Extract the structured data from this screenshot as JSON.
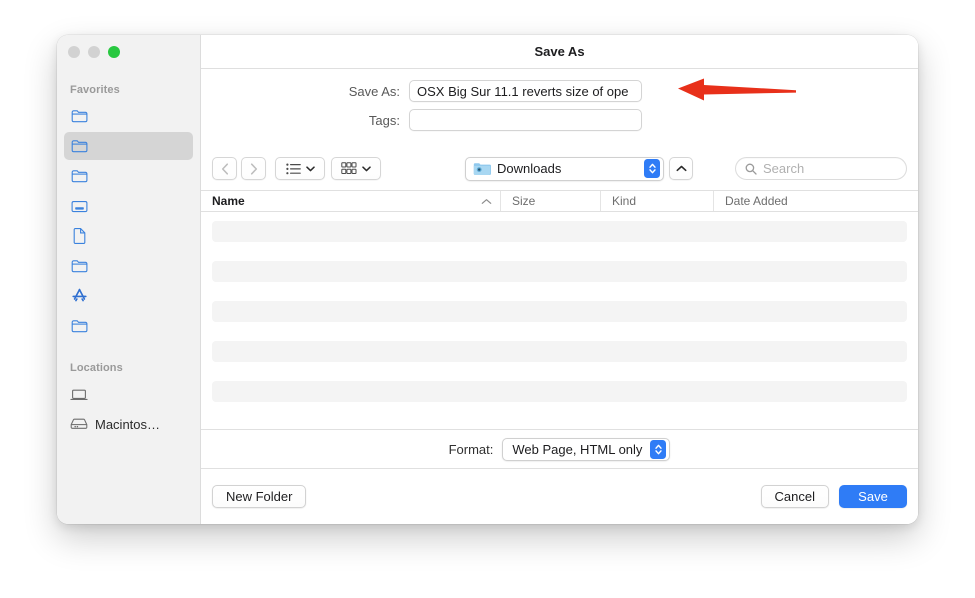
{
  "window": {
    "title": "Save As",
    "traffic_lights": [
      {
        "name": "close",
        "color": "#d2d2d2"
      },
      {
        "name": "minimize",
        "color": "#d2d2d2"
      },
      {
        "name": "zoom",
        "color": "#28c840"
      }
    ]
  },
  "sidebar": {
    "sections": [
      {
        "title": "Favorites",
        "items": [
          {
            "icon": "folder-icon",
            "label": "",
            "selected": false
          },
          {
            "icon": "folder-icon",
            "label": "",
            "selected": true
          },
          {
            "icon": "folder-icon",
            "label": "",
            "selected": false
          },
          {
            "icon": "desktop-icon",
            "label": "",
            "selected": false
          },
          {
            "icon": "document-icon",
            "label": "",
            "selected": false
          },
          {
            "icon": "folder-icon",
            "label": "",
            "selected": false
          },
          {
            "icon": "app-store-icon",
            "label": "",
            "selected": false
          },
          {
            "icon": "folder-icon",
            "label": "",
            "selected": false
          }
        ]
      },
      {
        "title": "Locations",
        "items": [
          {
            "icon": "laptop-icon",
            "label": "",
            "selected": false
          },
          {
            "icon": "hard-drive-icon",
            "label": "Macintos…",
            "selected": false
          }
        ]
      }
    ]
  },
  "name_fields": {
    "save_as_label": "Save As:",
    "save_as_value": "OSX Big Sur 11.1 reverts size of ope",
    "tags_label": "Tags:",
    "tags_value": "",
    "tags_placeholder": ""
  },
  "toolbar": {
    "back_icon": "chevron-left-icon",
    "forward_icon": "chevron-right-icon",
    "list_view_icon": "list-view-icon",
    "gallery_view_icon": "gallery-view-icon",
    "path_label": "Downloads",
    "path_icon": "downloads-folder-icon",
    "enclosing_folder_icon": "chevron-up-icon",
    "search_icon": "search-icon",
    "search_placeholder": "Search",
    "search_value": ""
  },
  "columns": [
    {
      "label": "Name",
      "sorted": true,
      "sort_icon": "chevron-up-icon"
    },
    {
      "label": "Size",
      "sorted": false
    },
    {
      "label": "Kind",
      "sorted": false
    },
    {
      "label": "Date Added",
      "sorted": false
    }
  ],
  "file_list": {
    "rows": [
      "",
      "",
      "",
      "",
      ""
    ]
  },
  "format": {
    "label": "Format:",
    "value": "Web Page, HTML only"
  },
  "actions": {
    "new_folder": "New Folder",
    "cancel": "Cancel",
    "save": "Save"
  },
  "annotation": {
    "arrow_color": "#e8301a",
    "direction": "left"
  },
  "colors": {
    "accent": "#2f7cf6",
    "sidebar_bg": "#f2f2f2",
    "window_bg": "#ffffff",
    "placeholder_row": "#f4f4f4"
  }
}
